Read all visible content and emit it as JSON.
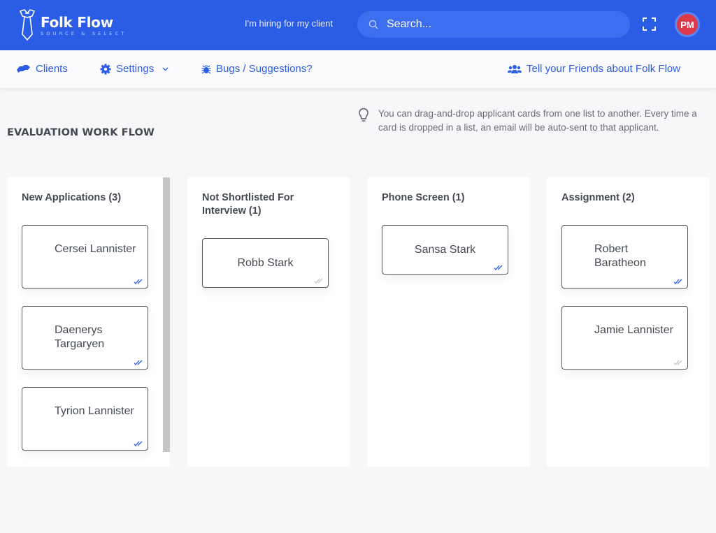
{
  "header": {
    "brand_title": "Folk Flow",
    "brand_subtitle": "SOURCE & SELECT",
    "hiring_label": "I'm hiring for my client",
    "search_placeholder": "Search...",
    "avatar_initials": "PM",
    "brand_color": "#2b5ce6"
  },
  "nav": {
    "clients": "Clients",
    "settings": "Settings",
    "bugs": "Bugs / Suggestions?",
    "tell_friends": "Tell your Friends about Folk Flow"
  },
  "page": {
    "title": "EVALUATION WORK FLOW",
    "tip": "You can drag-and-drop applicant cards from one list to another. Every time a card is dropped in a list, an email will be auto-sent to that applicant."
  },
  "columns": [
    {
      "title": "New Applications (3)",
      "cards": [
        {
          "name": "Cersei Lannister",
          "email_sent": true
        },
        {
          "name": "Daenerys Targaryen",
          "email_sent": true
        },
        {
          "name": "Tyrion Lannister",
          "email_sent": true
        }
      ]
    },
    {
      "title": "Not Shortlisted For Interview (1)",
      "cards": [
        {
          "name": "Robb Stark",
          "email_sent": false
        }
      ]
    },
    {
      "title": "Phone Screen (1)",
      "cards": [
        {
          "name": "Sansa Stark",
          "email_sent": true
        }
      ]
    },
    {
      "title": "Assignment (2)",
      "cards": [
        {
          "name": "Robert Baratheon",
          "email_sent": true
        },
        {
          "name": "Jamie Lannister",
          "email_sent": false
        }
      ]
    }
  ],
  "colors": {
    "check_sent": "#2b5ce6",
    "check_unsent": "#c4c4c4"
  }
}
